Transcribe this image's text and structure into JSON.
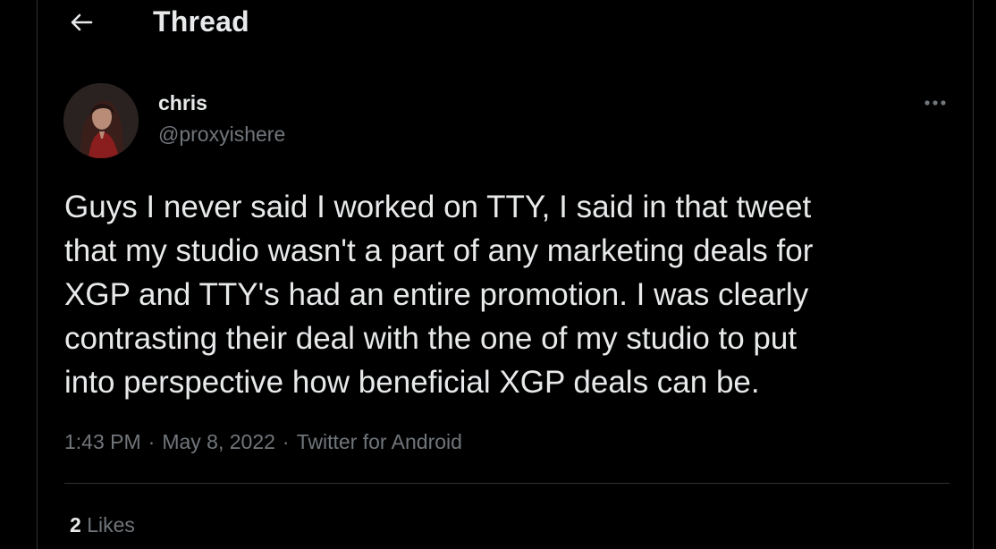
{
  "header": {
    "title": "Thread",
    "back_icon": "arrow-left-icon"
  },
  "tweet": {
    "author": {
      "display_name": "chris",
      "handle": "@proxyishere"
    },
    "text": "Guys I never said I worked on TTY, I said in that tweet\nthat my studio wasn't a part of any marketing deals for\nXGP and TTY's had an entire promotion. I was clearly\ncontrasting their deal with the one of my studio to put\ninto perspective how beneficial XGP deals can be.",
    "time": "1:43 PM",
    "separator": "·",
    "date": "May 8, 2022",
    "source": "Twitter for Android",
    "likes_count": "2",
    "likes_label": "Likes",
    "more_icon": "more-horizontal-icon"
  },
  "colors": {
    "background": "#000000",
    "primary_text": "#e7e9ea",
    "secondary_text": "#71767b",
    "border": "#2f3336"
  }
}
